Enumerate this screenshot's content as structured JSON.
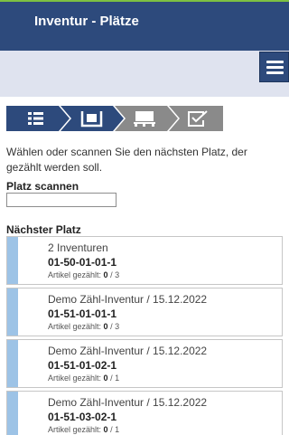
{
  "header": {
    "title": "Inventur - Plätze"
  },
  "steps": [
    {
      "name": "list",
      "icon": "list-icon",
      "active": true
    },
    {
      "name": "location",
      "icon": "pallet-location-icon",
      "active": true
    },
    {
      "name": "pallet",
      "icon": "pallet-icon",
      "active": false
    },
    {
      "name": "confirm",
      "icon": "checkbox-edit-icon",
      "active": false
    }
  ],
  "colors": {
    "header": "#2d4a7c",
    "step_active": "#2d4a7c",
    "step_inactive": "#8a8a8a",
    "accent": "#9dc3e6",
    "top_line": "#7dc142"
  },
  "instruction": "Wählen oder scannen Sie den nächsten Platz, der gezählt werden soll.",
  "scan": {
    "label": "Platz scannen",
    "value": ""
  },
  "next": {
    "label": "Nächster Platz"
  },
  "items": [
    {
      "title": "2 Inventuren",
      "code": "01-50-01-01-1",
      "counted_label": "Artikel gezählt:",
      "counted": "0",
      "total": "/ 3"
    },
    {
      "title": "Demo Zähl-Inventur / 15.12.2022",
      "code": "01-51-01-01-1",
      "counted_label": "Artikel gezählt:",
      "counted": "0",
      "total": "/ 3"
    },
    {
      "title": "Demo Zähl-Inventur / 15.12.2022",
      "code": "01-51-01-02-1",
      "counted_label": "Artikel gezählt:",
      "counted": "0",
      "total": "/ 1"
    },
    {
      "title": "Demo Zähl-Inventur / 15.12.2022",
      "code": "01-51-03-02-1",
      "counted_label": "Artikel gezählt:",
      "counted": "0",
      "total": "/ 1"
    }
  ]
}
